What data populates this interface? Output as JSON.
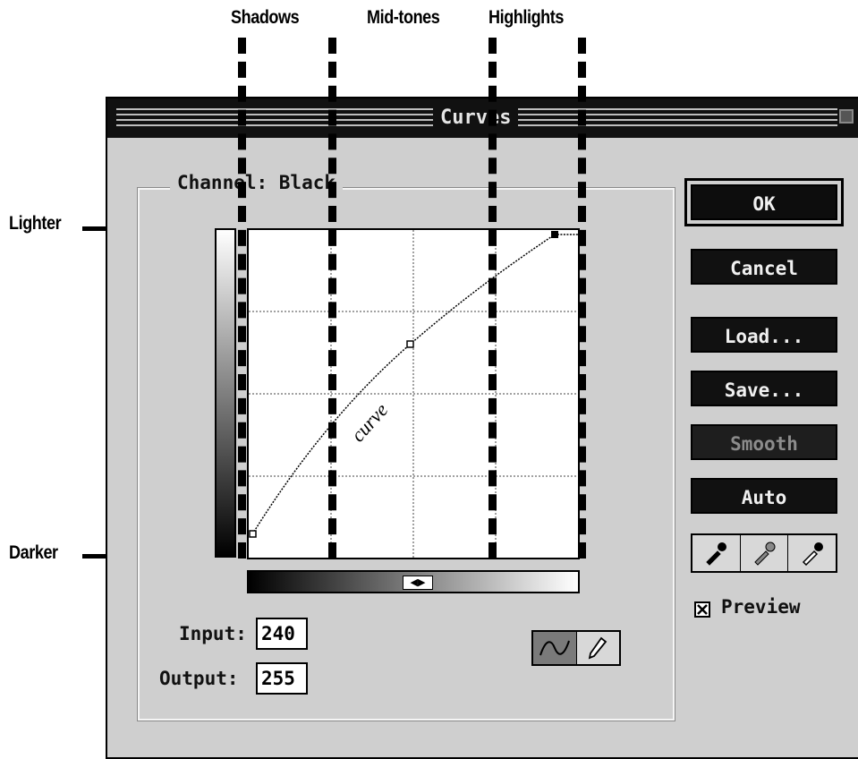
{
  "annotations": {
    "shadows": "Shadows",
    "midtones": "Mid-tones",
    "highlights": "Highlights",
    "lighter": "Lighter",
    "darker": "Darker",
    "curve_label": "curve"
  },
  "dialog": {
    "title": "Curves",
    "channel_label": "Channel: Black",
    "input_label": "Input:",
    "input_value": "240",
    "output_label": "Output:",
    "output_value": "255",
    "preview_label": "Preview",
    "preview_checked": true
  },
  "buttons": {
    "ok": "OK",
    "cancel": "Cancel",
    "load": "Load...",
    "save": "Save...",
    "smooth": "Smooth",
    "auto": "Auto"
  },
  "tools": {
    "curve_tool": "curve-tool-icon",
    "pencil_tool": "pencil-icon",
    "eyedroppers": [
      "black-eyedropper-icon",
      "gray-eyedropper-icon",
      "white-eyedropper-icon"
    ]
  },
  "curve_points": [
    {
      "input": 0,
      "output": 0
    },
    {
      "input": 128,
      "output": 163
    },
    {
      "input": 240,
      "output": 255
    },
    {
      "input": 255,
      "output": 255
    }
  ]
}
